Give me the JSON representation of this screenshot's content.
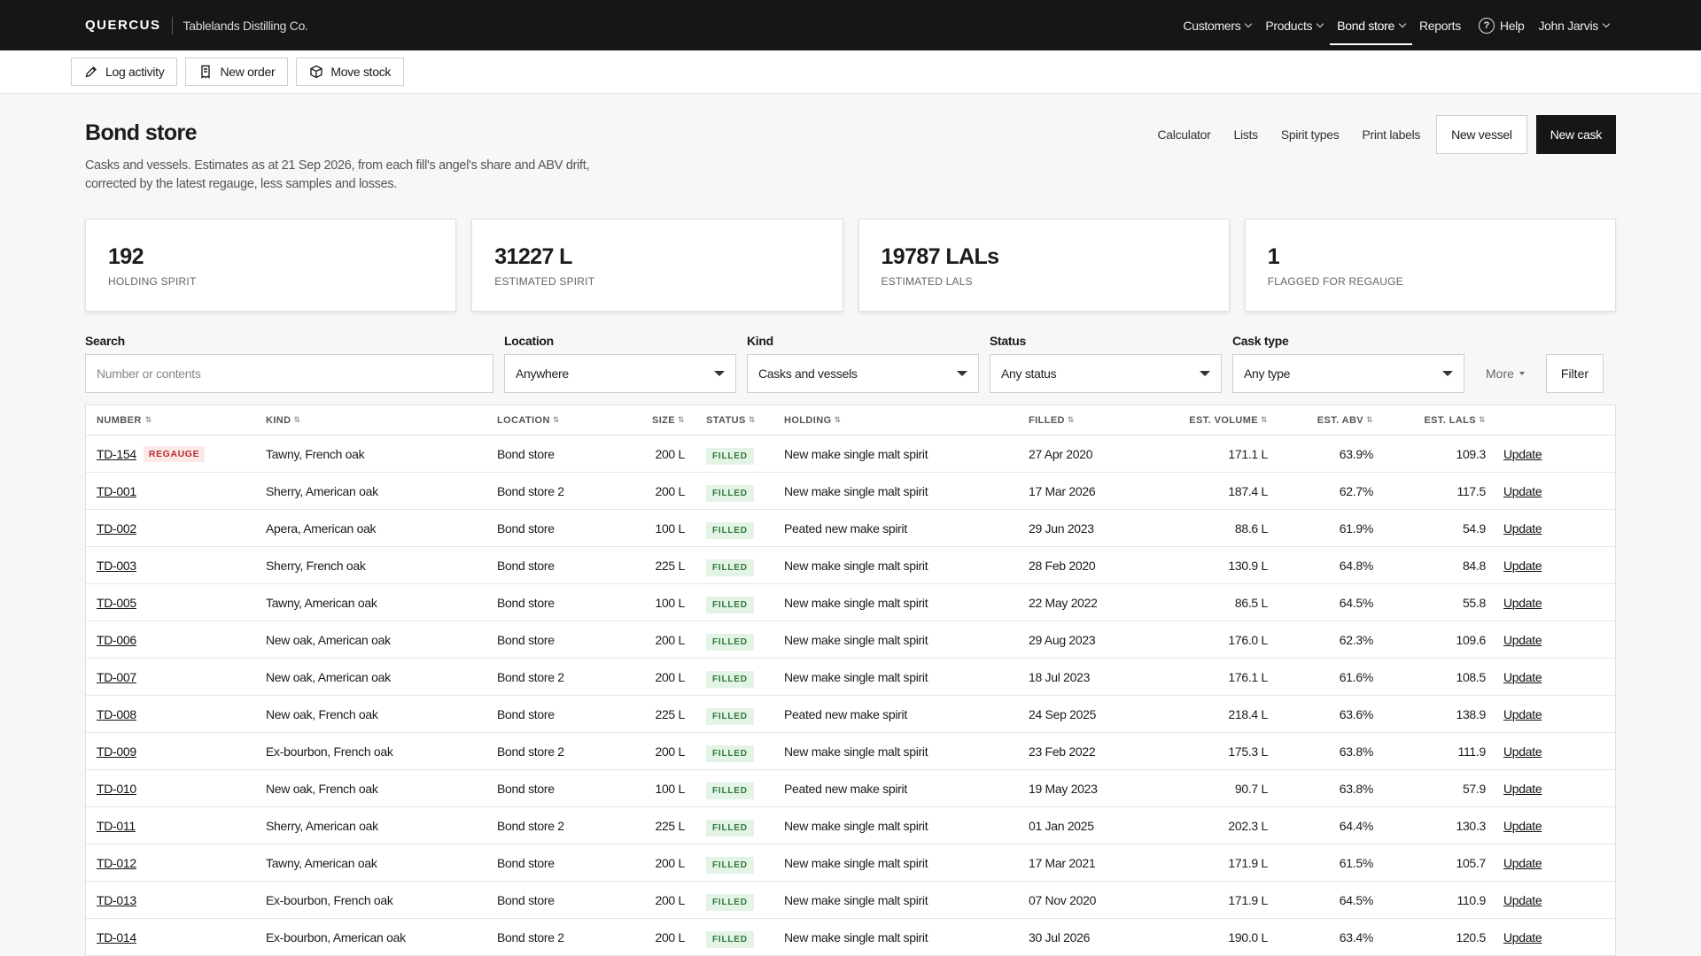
{
  "app": {
    "brand": "QUERCUS",
    "org": "Tablelands Distilling Co."
  },
  "nav": {
    "items": [
      {
        "label": "Customers",
        "dropdown": true,
        "active": false
      },
      {
        "label": "Products",
        "dropdown": true,
        "active": false
      },
      {
        "label": "Bond store",
        "dropdown": true,
        "active": true
      },
      {
        "label": "Reports",
        "dropdown": false,
        "active": false
      }
    ],
    "help": "Help",
    "user": "John Jarvis"
  },
  "actions": {
    "log_activity": "Log activity",
    "new_order": "New order",
    "move_stock": "Move stock"
  },
  "header": {
    "title": "Bond store",
    "subtitle": "Casks and vessels. Estimates as at 21 Sep 2026, from each fill's angel's share and ABV drift, corrected by the latest regauge, less samples and losses.",
    "links": [
      "Calculator",
      "Lists",
      "Spirit types",
      "Print labels"
    ],
    "new_vessel": "New vessel",
    "new_cask": "New cask"
  },
  "stats": [
    {
      "value": "192",
      "label": "Holding spirit"
    },
    {
      "value": "31227 L",
      "label": "Estimated spirit"
    },
    {
      "value": "19787 LALs",
      "label": "Estimated LALs"
    },
    {
      "value": "1",
      "label": "Flagged for regauge"
    }
  ],
  "filters": {
    "search_label": "Search",
    "search_placeholder": "Number or contents",
    "location_label": "Location",
    "location_value": "Anywhere",
    "kind_label": "Kind",
    "kind_value": "Casks and vessels",
    "status_label": "Status",
    "status_value": "Any status",
    "cask_label": "Cask type",
    "cask_value": "Any type",
    "more": "More",
    "filter": "Filter"
  },
  "table": {
    "headers": {
      "number": "Number",
      "kind": "Kind",
      "location": "Location",
      "size": "Size",
      "status": "Status",
      "holding": "Holding",
      "filled": "Filled",
      "volume": "Est. volume",
      "abv": "Est. ABV",
      "lals": "Est. LALs"
    },
    "sort_icon": "⇅",
    "action_label": "Update",
    "regauge_label": "REGAUGE",
    "rows": [
      {
        "number": "TD-154",
        "regauge": true,
        "kind": "Tawny, French oak",
        "location": "Bond store",
        "size": "200 L",
        "status": "FILLED",
        "holding": "New make single malt spirit",
        "filled": "27 Apr 2020",
        "volume": "171.1 L",
        "abv": "63.9%",
        "lals": "109.3"
      },
      {
        "number": "TD-001",
        "regauge": false,
        "kind": "Sherry, American oak",
        "location": "Bond store 2",
        "size": "200 L",
        "status": "FILLED",
        "holding": "New make single malt spirit",
        "filled": "17 Mar 2026",
        "volume": "187.4 L",
        "abv": "62.7%",
        "lals": "117.5"
      },
      {
        "number": "TD-002",
        "regauge": false,
        "kind": "Apera, American oak",
        "location": "Bond store",
        "size": "100 L",
        "status": "FILLED",
        "holding": "Peated new make spirit",
        "filled": "29 Jun 2023",
        "volume": "88.6 L",
        "abv": "61.9%",
        "lals": "54.9"
      },
      {
        "number": "TD-003",
        "regauge": false,
        "kind": "Sherry, French oak",
        "location": "Bond store",
        "size": "225 L",
        "status": "FILLED",
        "holding": "New make single malt spirit",
        "filled": "28 Feb 2020",
        "volume": "130.9 L",
        "abv": "64.8%",
        "lals": "84.8"
      },
      {
        "number": "TD-005",
        "regauge": false,
        "kind": "Tawny, American oak",
        "location": "Bond store",
        "size": "100 L",
        "status": "FILLED",
        "holding": "New make single malt spirit",
        "filled": "22 May 2022",
        "volume": "86.5 L",
        "abv": "64.5%",
        "lals": "55.8"
      },
      {
        "number": "TD-006",
        "regauge": false,
        "kind": "New oak, American oak",
        "location": "Bond store",
        "size": "200 L",
        "status": "FILLED",
        "holding": "New make single malt spirit",
        "filled": "29 Aug 2023",
        "volume": "176.0 L",
        "abv": "62.3%",
        "lals": "109.6"
      },
      {
        "number": "TD-007",
        "regauge": false,
        "kind": "New oak, American oak",
        "location": "Bond store 2",
        "size": "200 L",
        "status": "FILLED",
        "holding": "New make single malt spirit",
        "filled": "18 Jul 2023",
        "volume": "176.1 L",
        "abv": "61.6%",
        "lals": "108.5"
      },
      {
        "number": "TD-008",
        "regauge": false,
        "kind": "New oak, French oak",
        "location": "Bond store",
        "size": "225 L",
        "status": "FILLED",
        "holding": "Peated new make spirit",
        "filled": "24 Sep 2025",
        "volume": "218.4 L",
        "abv": "63.6%",
        "lals": "138.9"
      },
      {
        "number": "TD-009",
        "regauge": false,
        "kind": "Ex-bourbon, French oak",
        "location": "Bond store 2",
        "size": "200 L",
        "status": "FILLED",
        "holding": "New make single malt spirit",
        "filled": "23 Feb 2022",
        "volume": "175.3 L",
        "abv": "63.8%",
        "lals": "111.9"
      },
      {
        "number": "TD-010",
        "regauge": false,
        "kind": "New oak, French oak",
        "location": "Bond store",
        "size": "100 L",
        "status": "FILLED",
        "holding": "Peated new make spirit",
        "filled": "19 May 2023",
        "volume": "90.7 L",
        "abv": "63.8%",
        "lals": "57.9"
      },
      {
        "number": "TD-011",
        "regauge": false,
        "kind": "Sherry, American oak",
        "location": "Bond store 2",
        "size": "225 L",
        "status": "FILLED",
        "holding": "New make single malt spirit",
        "filled": "01 Jan 2025",
        "volume": "202.3 L",
        "abv": "64.4%",
        "lals": "130.3"
      },
      {
        "number": "TD-012",
        "regauge": false,
        "kind": "Tawny, American oak",
        "location": "Bond store",
        "size": "200 L",
        "status": "FILLED",
        "holding": "New make single malt spirit",
        "filled": "17 Mar 2021",
        "volume": "171.9 L",
        "abv": "61.5%",
        "lals": "105.7"
      },
      {
        "number": "TD-013",
        "regauge": false,
        "kind": "Ex-bourbon, French oak",
        "location": "Bond store",
        "size": "200 L",
        "status": "FILLED",
        "holding": "New make single malt spirit",
        "filled": "07 Nov 2020",
        "volume": "171.9 L",
        "abv": "64.5%",
        "lals": "110.9"
      },
      {
        "number": "TD-014",
        "regauge": false,
        "kind": "Ex-bourbon, American oak",
        "location": "Bond store 2",
        "size": "200 L",
        "status": "FILLED",
        "holding": "New make single malt spirit",
        "filled": "30 Jul 2026",
        "volume": "190.0 L",
        "abv": "63.4%",
        "lals": "120.5"
      }
    ]
  }
}
